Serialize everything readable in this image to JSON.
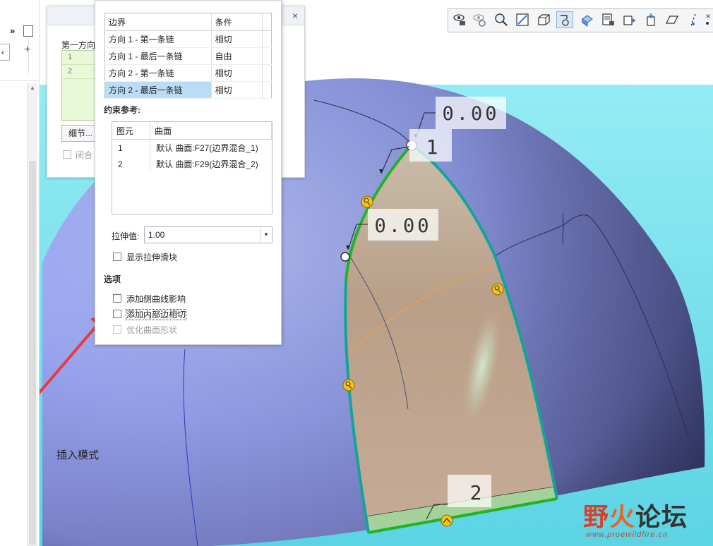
{
  "back_dialog": {
    "direction_label": "第一方向",
    "rows": [
      "1",
      "2"
    ],
    "detail_button": "细节...",
    "closed_label": "闭合",
    "close_glyph": "×"
  },
  "left_panel": {
    "expand_glyph": "»",
    "back_glyph": "‹",
    "add_glyph": "+"
  },
  "boundary_table": {
    "headers": [
      "边界",
      "条件"
    ],
    "rows": [
      [
        "方向 1 - 第一条链",
        "相切"
      ],
      [
        "方向 1 - 最后一条链",
        "自由"
      ],
      [
        "方向 2 - 第一条链",
        "相切"
      ],
      [
        "方向 2 - 最后一条链",
        "相切"
      ]
    ],
    "selected_index": 3
  },
  "constraint_refs": {
    "label": "约束参考:",
    "headers": [
      "图元",
      "曲面"
    ],
    "rows": [
      [
        "1",
        "默认 曲面:F27(边界混合_1)"
      ],
      [
        "2",
        "默认 曲面:F29(边界混合_2)"
      ]
    ]
  },
  "stretch": {
    "label": "拉伸值:",
    "value": "1.00",
    "show_slider": "显示拉伸滑块"
  },
  "options": {
    "title": "选项",
    "add_side_curve": "添加侧曲线影响",
    "add_inner_tangent": "添加内部边相切",
    "optimize_surface": "优化曲面形状"
  },
  "viewport": {
    "dim_1": "0.00",
    "dim_2": "0.00",
    "chain_label_1": "1",
    "chain_label_2": "2",
    "status": "插入模式"
  },
  "toolbar": {
    "icons": [
      "saved-view-icon",
      "repaint-icon",
      "zoom-icon",
      "refit-icon",
      "display-style-icon",
      "spin-center-icon",
      "named-view-icon",
      "view-manager-icon",
      "appearance-icon",
      "section-icon",
      "perspective-icon",
      "datum-display-icon",
      "annotation-icon"
    ]
  },
  "watermark": {
    "part1": "野",
    "part2": "火",
    "part3": "论坛",
    "url": "www.proewildfire.cn"
  },
  "colors": {
    "surface_blue": "#9aa6ee",
    "surface_shadow": "#4a4d7c",
    "cyan_bg": "#6fdbe9",
    "patch_fill": "#c3a890",
    "green_edge": "#22b322",
    "teal_edge": "#12a49a",
    "marker_yellow": "#f6c418",
    "selection_blue": "#b9dcf7",
    "watermark_red": "#d8402a",
    "watermark_dark": "#333333",
    "arrow_red": "#ec3a3a"
  }
}
